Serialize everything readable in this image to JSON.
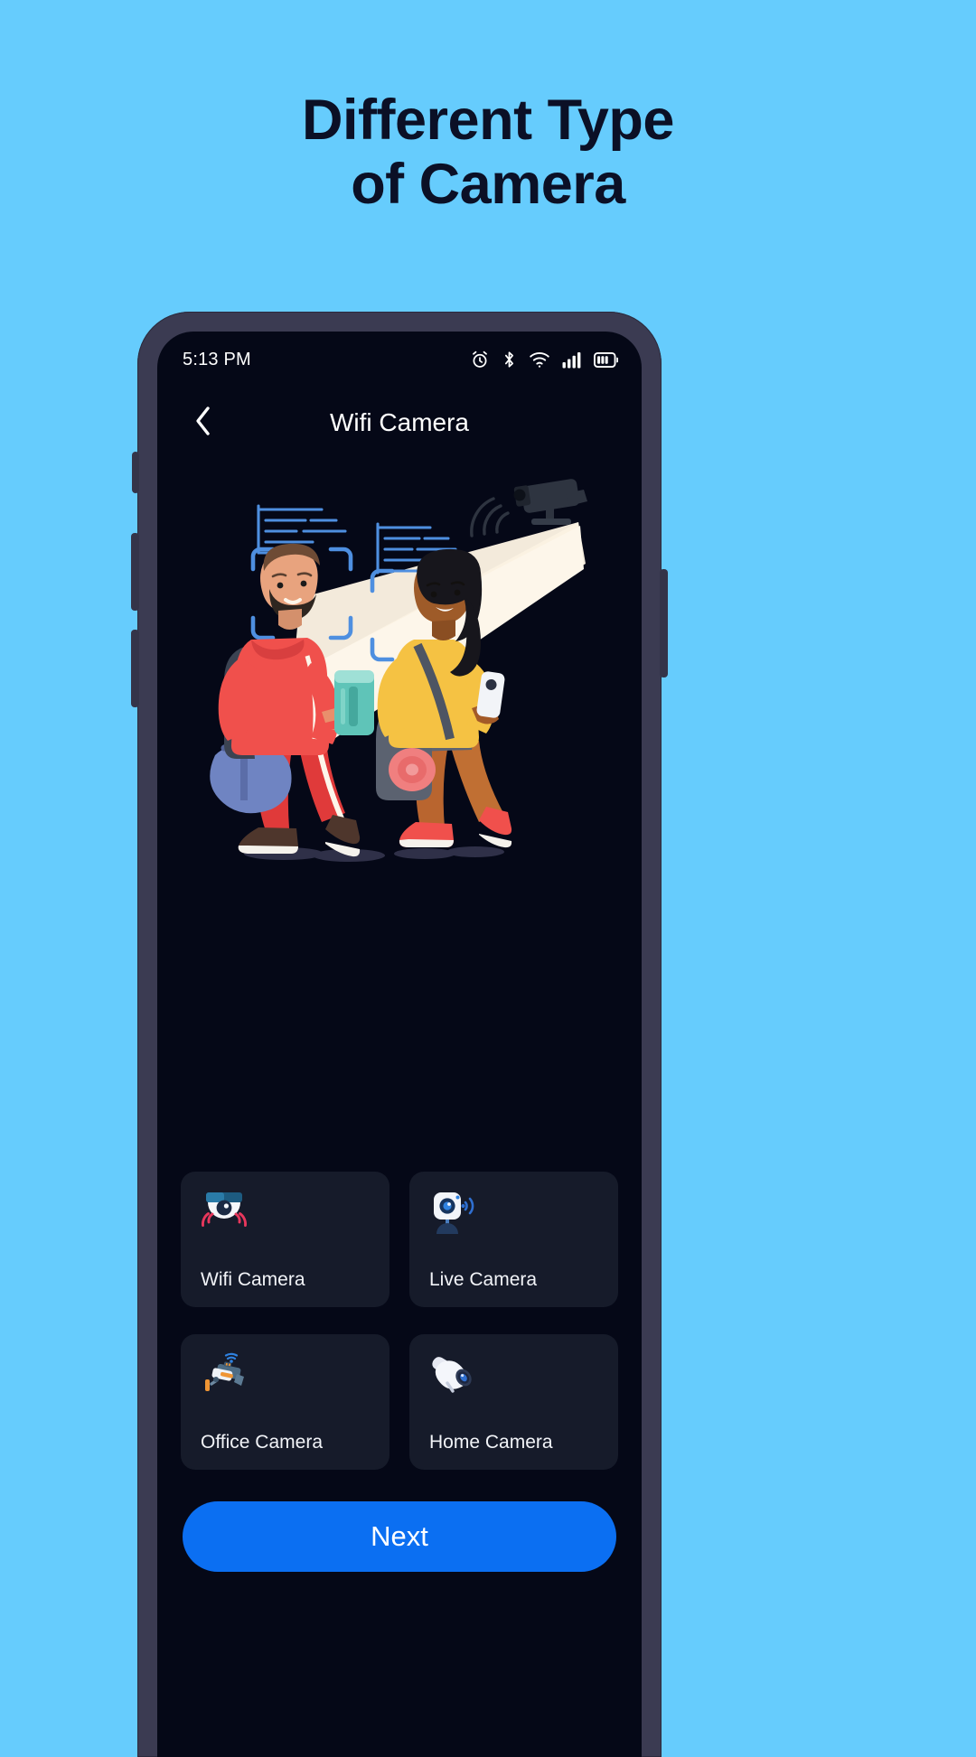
{
  "background_color": "#66ccfd",
  "heading": {
    "line1": "Different Type",
    "line2": "of Camera",
    "color": "#0b1026"
  },
  "phone": {
    "bezel_color": "#3b3b52",
    "screen_color": "#050817"
  },
  "status_bar": {
    "time": "5:13 PM",
    "icons": [
      "alarm-icon",
      "bluetooth-icon",
      "wifi-icon",
      "cellular-signal-icon",
      "battery-icon"
    ]
  },
  "app_header": {
    "back_icon": "chevron-left-icon",
    "title": "Wifi Camera"
  },
  "illustration": {
    "name": "surveillance-cctv-illustration",
    "description": "CCTV camera scanning two walking travellers with face-detection brackets and data readout lines",
    "light_cone_color": "#fdf4e3",
    "bracket_color": "#4e8fe0",
    "data_line_color": "#4e8fe0"
  },
  "cards": [
    {
      "label": "Wifi Camera",
      "icon": "dome-camera-icon",
      "selected": true
    },
    {
      "label": "Live Camera",
      "icon": "webcam-icon",
      "selected": false
    },
    {
      "label": "Office Camera",
      "icon": "ptz-camera-icon",
      "selected": false
    },
    {
      "label": "Home Camera",
      "icon": "bullet-camera-icon",
      "selected": false
    }
  ],
  "next_button": {
    "label": "Next",
    "color": "#0b6ff2"
  }
}
